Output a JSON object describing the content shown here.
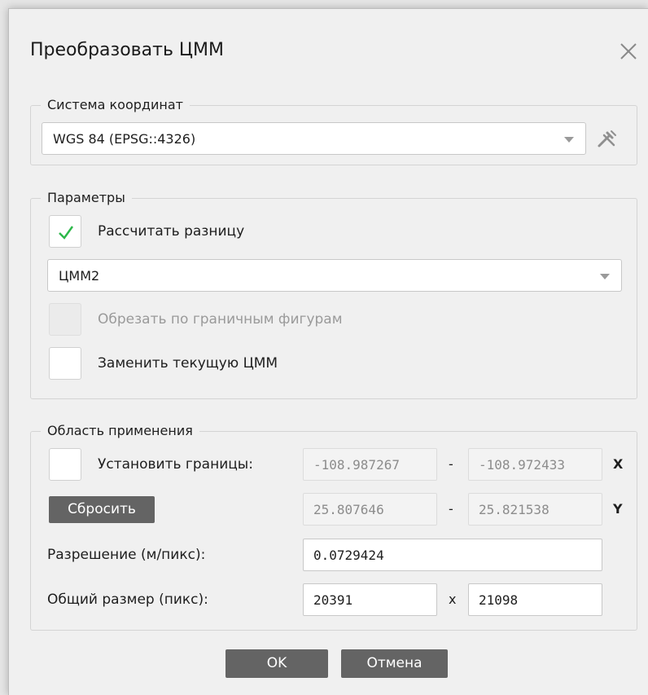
{
  "dialog": {
    "title": "Преобразовать ЦММ",
    "close_icon": "close-icon"
  },
  "crs_group": {
    "legend": "Система координат",
    "selected": "WGS 84 (EPSG::4326)",
    "settings_icon": "tools-icon"
  },
  "params_group": {
    "legend": "Параметры",
    "calc_diff": {
      "label": "Рассчитать разницу",
      "checked": true
    },
    "dem_selected": "ЦММ2",
    "clip": {
      "label": "Обрезать по граничным фигурам",
      "checked": false,
      "enabled": false
    },
    "replace": {
      "label": "Заменить текущую ЦММ",
      "checked": false
    }
  },
  "region_group": {
    "legend": "Область применения",
    "set_bounds_label": "Установить границы:",
    "x_min": "-108.987267",
    "x_max": "-108.972433",
    "x_axis": "X",
    "y_min": "25.807646",
    "y_max": "25.821538",
    "y_axis": "Y",
    "dash": "-",
    "reset_label": "Сбросить",
    "resolution_label": "Разрешение (м/пикс):",
    "resolution_value": "0.0729424",
    "size_label": "Общий размер (пикс):",
    "width": "20391",
    "times": "x",
    "height": "21098"
  },
  "footer": {
    "ok_label": "OK",
    "cancel_label": "Отмена"
  },
  "colors": {
    "check": "#2db84a",
    "button": "#646464",
    "dialog_bg": "#f0f0f0"
  }
}
